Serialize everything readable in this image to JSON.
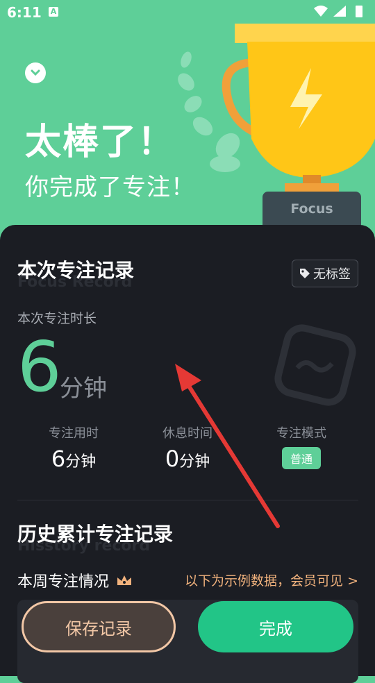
{
  "status_bar": {
    "time": "6:11",
    "notification_glyph": "A"
  },
  "hero": {
    "title": "太棒了！",
    "subtitle": "你完成了专注！",
    "plate_text": "Focus"
  },
  "record": {
    "title": "本次专注记录",
    "title_watermark": "Focus Record",
    "tag_label": "无标签",
    "duration_label": "本次专注时长",
    "duration_value": "6",
    "duration_unit": "分钟",
    "stats": [
      {
        "label": "专注用时",
        "value": "6",
        "unit": "分钟"
      },
      {
        "label": "休息时间",
        "value": "0",
        "unit": "分钟"
      },
      {
        "label": "专注模式",
        "badge": "普通"
      }
    ]
  },
  "history": {
    "title": "历史累计专注记录",
    "title_watermark": "Hisstory record",
    "week_label": "本周专注情况",
    "member_link": "以下为示例数据，会员可见 >"
  },
  "buttons": {
    "save": "保存记录",
    "done": "完成"
  },
  "colors": {
    "brand_green": "#5ecf98",
    "done_green": "#22c587",
    "card_bg": "#1b1d23",
    "accent_peach": "#f2c7a6",
    "arrow_red": "#e53935"
  }
}
